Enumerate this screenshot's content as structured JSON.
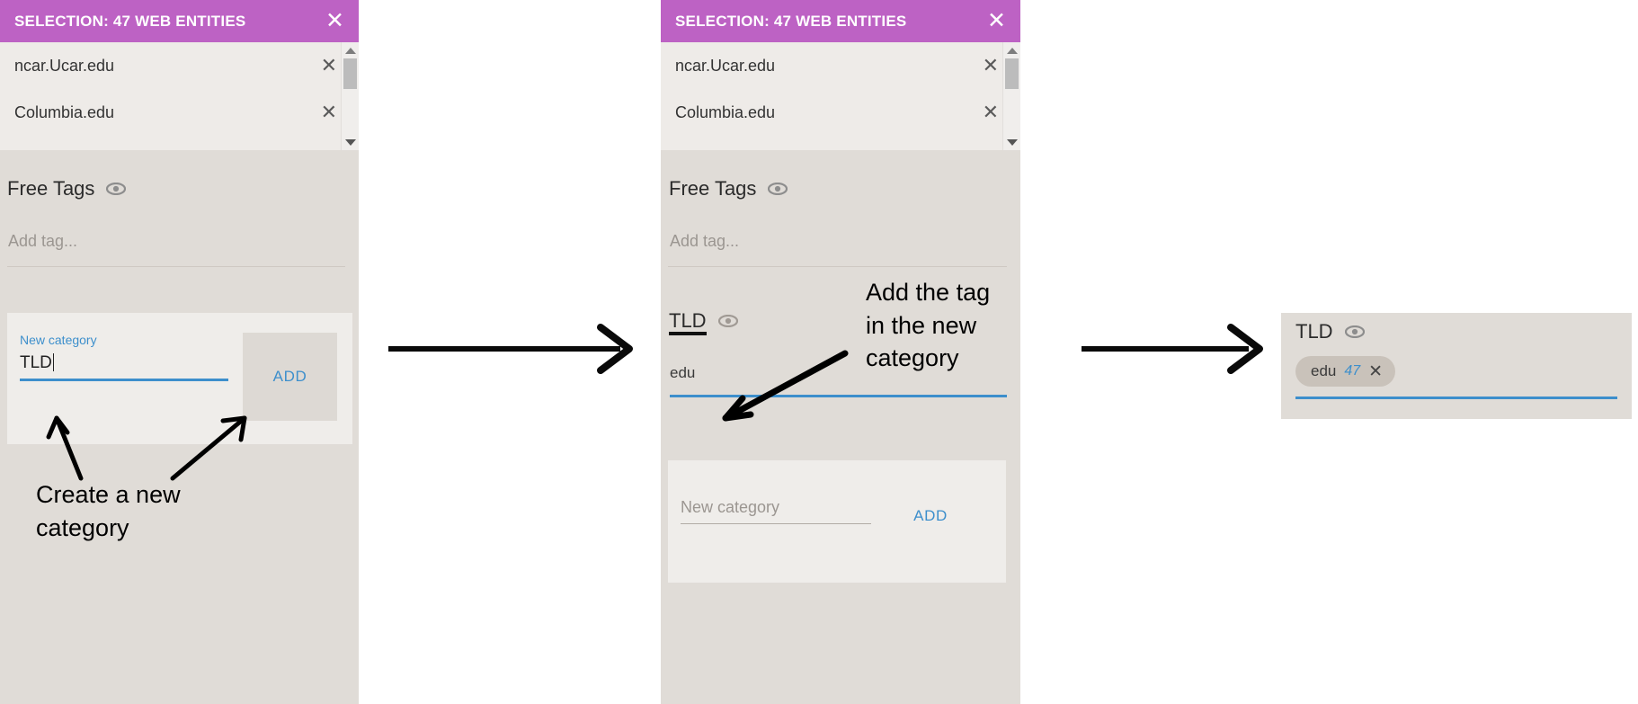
{
  "panel1": {
    "header": {
      "title": "SELECTION: 47 WEB ENTITIES",
      "close_icon": "close-icon",
      "bg": "#bd62c4"
    },
    "entities": [
      {
        "name": "ncar.Ucar.edu",
        "remove_icon": "close-icon"
      },
      {
        "name": "Columbia.edu",
        "remove_icon": "close-icon"
      }
    ],
    "free_tags": {
      "title": "Free Tags",
      "eye_icon": "eye-icon",
      "input_placeholder": "Add tag..."
    },
    "new_category": {
      "float_label": "New category",
      "value": "TLD",
      "add_label": "ADD"
    }
  },
  "panel2": {
    "header": {
      "title": "SELECTION: 47 WEB ENTITIES",
      "close_icon": "close-icon",
      "bg": "#bd62c4"
    },
    "entities": [
      {
        "name": "ncar.Ucar.edu",
        "remove_icon": "close-icon"
      },
      {
        "name": "Columbia.edu",
        "remove_icon": "close-icon"
      }
    ],
    "free_tags": {
      "title": "Free Tags",
      "eye_icon": "eye-icon",
      "input_placeholder": "Add tag..."
    },
    "tld_category": {
      "title": "TLD",
      "eye_icon": "eye-icon",
      "tag_value": "edu"
    },
    "new_category": {
      "placeholder": "New category",
      "value": "",
      "add_label": "ADD"
    }
  },
  "panel3": {
    "tld_category": {
      "title": "TLD",
      "eye_icon": "eye-icon",
      "chip": {
        "label": "edu",
        "count": "47",
        "remove_icon": "close-icon"
      }
    }
  },
  "annotations": {
    "create_category": "Create a new\ncategory",
    "add_tag": "Add the tag\nin the new\ncategory"
  },
  "colors": {
    "header_purple": "#bd62c4",
    "accent_blue": "#3d8fcc",
    "panel_bg": "#e0dcd7",
    "list_bg": "#eeebe8",
    "card_bg": "#efedea",
    "chip_bg": "#c9c2ba"
  }
}
